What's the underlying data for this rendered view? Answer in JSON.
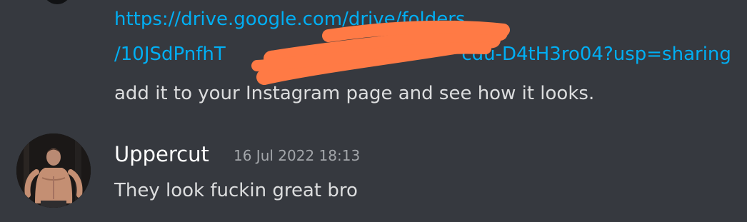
{
  "previous_message": {
    "link_line_1": "https://drive.google.com/drive/folders",
    "link_line_2": "/10JSdPnfhT                                        cdu-D4tH3ro04?usp=sharing",
    "text": "add it to your Instagram page and see how it looks."
  },
  "message": {
    "author": "Uppercut",
    "timestamp": "16 Jul 2022 18:13",
    "text": "They look fuckin great bro"
  },
  "colors": {
    "background": "#36393f",
    "link": "#00aff4",
    "text": "#dcddde",
    "username": "#ffffff",
    "timestamp": "#a3a6aa",
    "redaction": "#ff7a45"
  }
}
